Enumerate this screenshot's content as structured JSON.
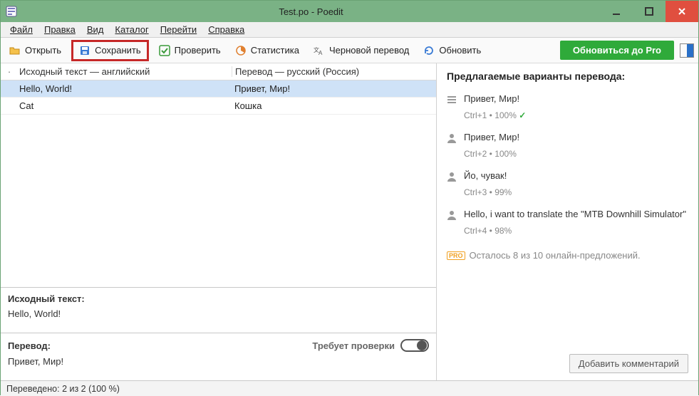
{
  "window": {
    "title": "Test.po - Poedit"
  },
  "menu": {
    "file": "Файл",
    "edit": "Правка",
    "view": "Вид",
    "catalog": "Каталог",
    "go": "Перейти",
    "help": "Справка"
  },
  "toolbar": {
    "open": "Открыть",
    "save": "Сохранить",
    "validate": "Проверить",
    "stats": "Статистика",
    "pretranslate": "Черновой перевод",
    "update": "Обновить",
    "pro": "Обновиться до Pro"
  },
  "columns": {
    "source": "Исходный текст — английский",
    "target": "Перевод — русский (Россия)"
  },
  "rows": [
    {
      "src": "Hello, World!",
      "trg": "Привет, Мир!"
    },
    {
      "src": "Cat",
      "trg": "Кошка"
    }
  ],
  "editor": {
    "source_label": "Исходный текст:",
    "source_text": "Hello, World!",
    "target_label": "Перевод:",
    "needs_work": "Требует проверки",
    "target_text": "Привет, Мир!"
  },
  "suggestions": {
    "title": "Предлагаемые варианты перевода:",
    "items": [
      {
        "text": "Привет, Мир!",
        "meta": "Ctrl+1 • 100% ",
        "ok": "✓",
        "kind": "tm"
      },
      {
        "text": "Привет, Мир!",
        "meta": "Ctrl+2 • 100%",
        "kind": "user"
      },
      {
        "text": "Йо, чувак!",
        "meta": "Ctrl+3 • 99%",
        "kind": "user"
      },
      {
        "text": "Hello, i want to translate the \"MTB Downhill Simulator\"",
        "meta": "Ctrl+4 • 98%",
        "kind": "user"
      }
    ],
    "remaining": "Осталось 8 из 10 онлайн-предложений.",
    "add_comment": "Добавить комментарий"
  },
  "status": {
    "text": "Переведено: 2 из 2 (100 %)"
  }
}
